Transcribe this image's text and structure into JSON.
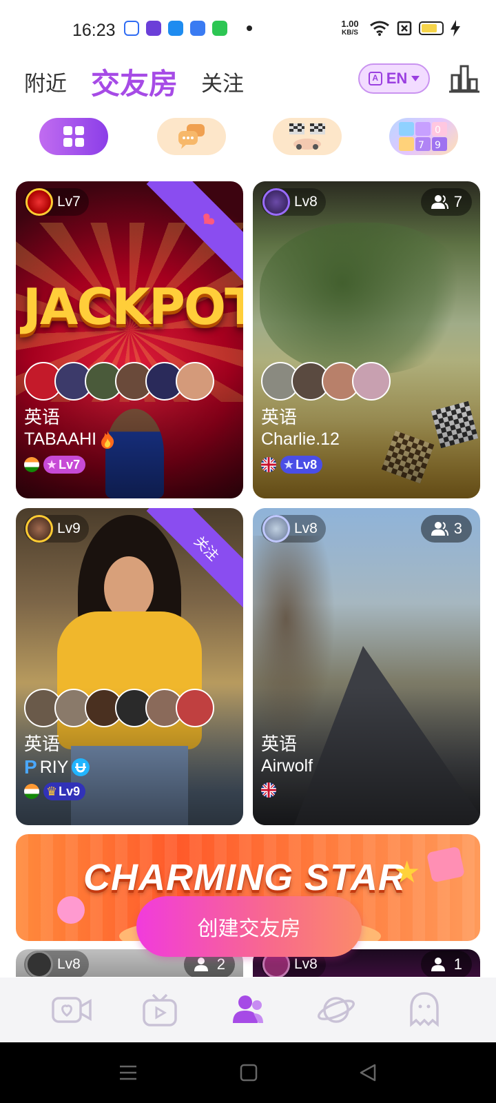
{
  "status": {
    "time": "16:23",
    "net_speed_value": "1.00",
    "net_speed_unit": "KB/S"
  },
  "header": {
    "tabs": [
      "附近",
      "交友房",
      "关注"
    ],
    "active_tab": "交友房",
    "language": "EN"
  },
  "filters": [
    "all-grid",
    "chat",
    "racing",
    "number-puzzle"
  ],
  "rooms": [
    {
      "host_level": "Lv7",
      "language": "英语",
      "name": "TABAAHI",
      "name_suffix_icon": "fire-icon",
      "country": "India",
      "user_level": "Lv7",
      "ribbon": "heart-wings",
      "cover_text": "JACKPOT"
    },
    {
      "host_level": "Lv8",
      "viewer_count": "7",
      "language": "英语",
      "name": "Charlie.12",
      "country": "United Kingdom",
      "user_level": "Lv8"
    },
    {
      "host_level": "Lv9",
      "language": "英语",
      "name_prefix": "P",
      "name": "RIY",
      "name_suffix_icon": "u-turn-badge-icon",
      "country": "India",
      "user_level": "Lv9",
      "ribbon_text": "关注"
    },
    {
      "host_level": "Lv8",
      "viewer_count": "3",
      "language": "英语",
      "name": "Airwolf",
      "country": "United Kingdom"
    },
    {
      "host_level": "Lv8",
      "viewer_count": "2"
    },
    {
      "host_level": "Lv8",
      "viewer_count": "1"
    }
  ],
  "banner": {
    "title": "CHARMING STAR"
  },
  "create_button": "创建交友房",
  "bottom_nav": [
    "live-video",
    "tv-play",
    "party-rooms",
    "planet",
    "ghost-chat"
  ],
  "active_nav": "party-rooms",
  "colors": {
    "accent": "#a64be6",
    "lv_pink": "#c74ad6",
    "lv_blue": "#4a4ee6",
    "lv_navy": "#3132b8"
  }
}
